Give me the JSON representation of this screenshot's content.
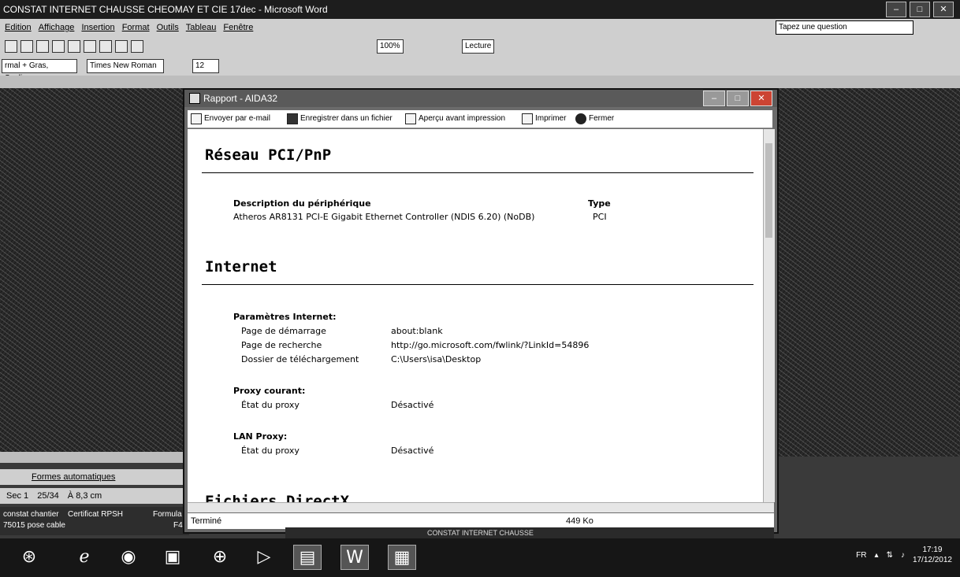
{
  "word": {
    "title": "CONSTAT INTERNET CHAUSSE CHEOMAY ET CIE 17dec - Microsoft Word",
    "menu": [
      "Edition",
      "Affichage",
      "Insertion",
      "Format",
      "Outils",
      "Tableau",
      "Fenêtre"
    ],
    "help_placeholder": "Tapez une question",
    "zoom": "100%",
    "lecture_label": "Lecture",
    "style_box": "rmal + Gras, Soulign",
    "font_box": "Times New Roman",
    "size_box": "12",
    "draw_label": "Formes automatiques",
    "status": {
      "section": "Sec 1",
      "pages": "25/34",
      "position": "À 8,3 cm"
    },
    "files": [
      "constat chantier",
      "Certificat RPSH",
      "Formula",
      "75015 pose cable",
      "F4"
    ]
  },
  "report": {
    "title": "Rapport - AIDA32",
    "toolbar": {
      "email": "Envoyer par e-mail",
      "save": "Enregistrer dans un fichier",
      "preview": "Aperçu avant impression",
      "print": "Imprimer",
      "close": "Fermer"
    },
    "section1": {
      "title": "Réseau PCI/PnP",
      "col_desc": "Description du périphérique",
      "col_type": "Type",
      "device": "Atheros AR8131 PCI-E Gigabit Ethernet Controller (NDIS 6.20) (NoDB)",
      "device_type": "PCI"
    },
    "section2": {
      "title": "Internet",
      "params_heading": "Paramètres Internet:",
      "start_label": "Page de démarrage",
      "start_value": "about:blank",
      "search_label": "Page de recherche",
      "search_value": "http://go.microsoft.com/fwlink/?LinkId=54896",
      "download_label": "Dossier de téléchargement",
      "download_value": "C:\\Users\\isa\\Desktop",
      "proxy_heading": "Proxy courant:",
      "proxy_label": "État du proxy",
      "proxy_value": "Désactivé",
      "lan_heading": "LAN Proxy:",
      "lan_label": "État du proxy",
      "lan_value": "Désactivé"
    },
    "next_section_partial": "Fichiers DirectX",
    "status_left": "Terminé",
    "status_size": "449 Ko"
  },
  "taskbar": {
    "strip_text": "CONSTAT INTERNET CHAUSSE",
    "lang": "FR",
    "time": "17:19",
    "date": "17/12/2012"
  }
}
